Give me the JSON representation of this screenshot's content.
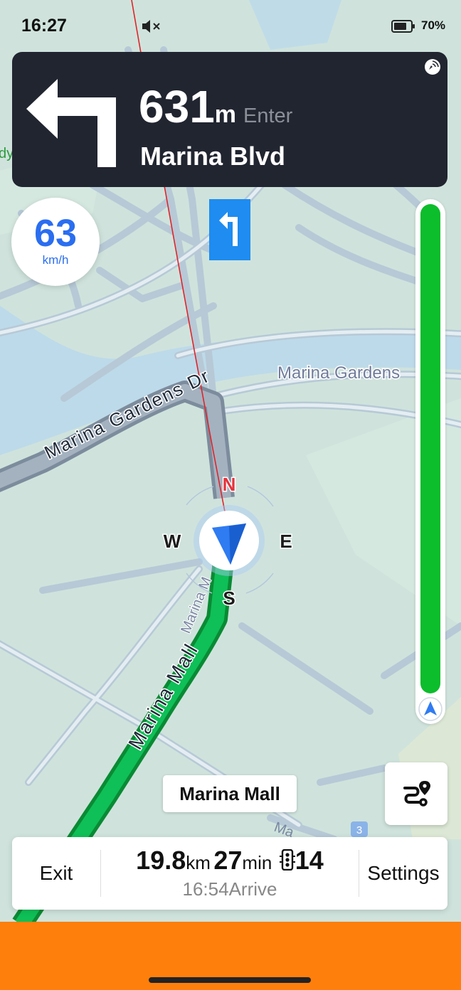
{
  "status_bar": {
    "time": "16:27",
    "battery_percent": "70%"
  },
  "navigation": {
    "distance_value": "631",
    "distance_unit": "m",
    "action": "Enter",
    "street": "Marina Blvd",
    "maneuver": "turn-left"
  },
  "speed": {
    "value": "63",
    "unit": "km/h"
  },
  "route_progress_fraction": 0.95,
  "map": {
    "labels": {
      "marina_gardens": "Marina Gardens",
      "marina_gardens_dr": "Marina Gardens Dr",
      "marina_mall_road": "Marina Mall",
      "marina_mall_minor": "Marina M",
      "ma_partial": "Ma",
      "road_shield": "3",
      "left_edge": "dy"
    },
    "compass": {
      "north": "N",
      "south": "S",
      "east": "E",
      "west": "W"
    },
    "poi_label": "Marina Mall"
  },
  "bottom_panel": {
    "exit_label": "Exit",
    "distance_value": "19.8",
    "distance_unit": "km",
    "time_value": "27",
    "time_unit": "min",
    "traffic_lights": "14",
    "arrive_text": "16:54Arrive",
    "settings_label": "Settings"
  },
  "colors": {
    "map_background": "#cfe3dc",
    "banner": "#212530",
    "route_green": "#0cbd2c",
    "speed_blue": "#2a6ef0",
    "bottom_bar": "#ff7f0c"
  }
}
